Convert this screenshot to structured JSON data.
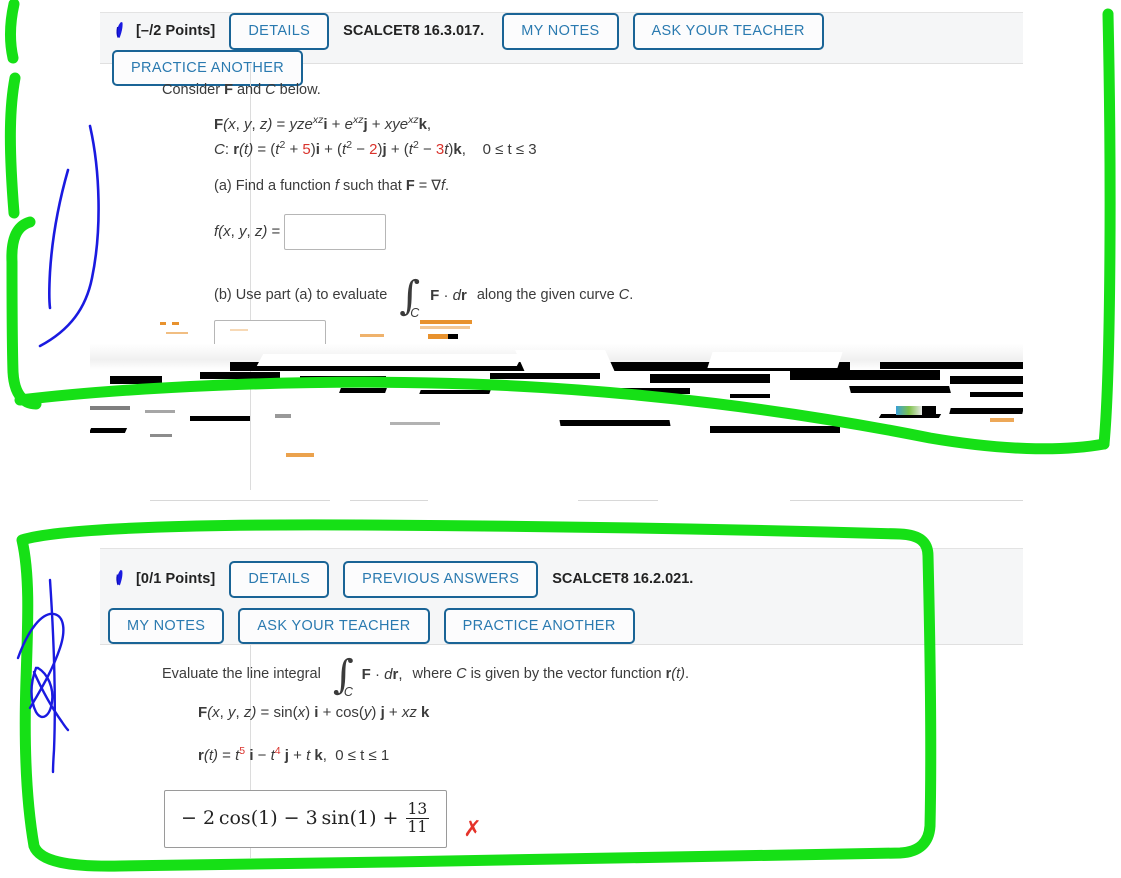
{
  "questions": [
    {
      "id": "q1",
      "icon_name": "handwriting-pen-icon",
      "points": "[–/2 Points]",
      "buttons": [
        "DETAILS",
        "MY NOTES",
        "ASK YOUR TEACHER",
        "PRACTICE ANOTHER"
      ],
      "tag": "SCALCET8 16.3.017.",
      "prompt": "Consider F and C below.",
      "field_F_lhs": "F(x, y, z) = ",
      "field_F_rhs": "yze",
      "field_C_label": "C: ",
      "part_a": "(a) Find a function f such that F = ∇f.",
      "answer_a_label": "f(x, y, z) = ",
      "answer_a_value": "",
      "part_b_pre": "(b) Use part (a) to evaluate",
      "part_b_integrand": "F · dr",
      "part_b_post": "along the given curve C.",
      "answer_b_value": "",
      "t_range": "0 ≤ t ≤ 3"
    },
    {
      "id": "q2",
      "icon_name": "handwriting-pen-icon",
      "points": "[0/1 Points]",
      "buttons_row1": [
        "DETAILS",
        "PREVIOUS ANSWERS"
      ],
      "buttons_row2": [
        "MY NOTES",
        "ASK YOUR TEACHER",
        "PRACTICE ANOTHER"
      ],
      "tag": "SCALCET8 16.2.021.",
      "prompt_pre": "Evaluate the line integral",
      "prompt_integrand": "F · dr,",
      "prompt_post": "where C is given by the vector function r(t).",
      "field_F": "F(x, y, z) = sin(x) i + cos(y) j + xz k",
      "field_r": "r(t) = ",
      "t_range": "0 ≤ t ≤ 1",
      "student_answer": "− 2 cos(1) − 3 sin(1) + 13/11",
      "answer_numerator": "13",
      "answer_denominator": "11",
      "grade_icon": "✗",
      "grade_status": "incorrect"
    }
  ],
  "colors": {
    "button_border": "#1a6496",
    "button_text": "#2a7ab0",
    "header_bg": "#f5f6f7",
    "math_red": "#d9332c",
    "incorrect_red": "#e5332a",
    "annotation_green": "#16e016",
    "annotation_blue": "#1a1ae0"
  },
  "annotations": {
    "green_marker": "hand-drawn green highlighter brackets and enclosing loop",
    "blue_pen": "hand-drawn blue pen curves and scribble"
  }
}
